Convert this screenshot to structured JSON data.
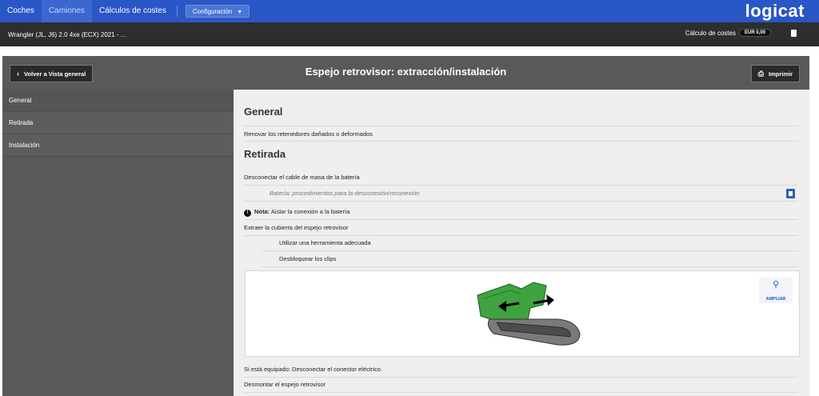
{
  "nav": {
    "items": [
      "Coches",
      "Camiones",
      "Cálculos de costes"
    ],
    "config_label": "Configuración",
    "logo": "logicat"
  },
  "vehicle": {
    "title": "Wrangler (JL, J6) 2.0 4xe (ECX) 2021 - ...",
    "cost_label": "Cálculo de costes",
    "cost_value": "EUR 0,00"
  },
  "header": {
    "back_label": "Volver a Vista general",
    "title": "Espejo retrovisor: extracción/instalación",
    "print_label": "Imprimir"
  },
  "sidebar": {
    "items": [
      "General",
      "Retirada",
      "Instalación"
    ]
  },
  "content": {
    "general_heading": "General",
    "general_rows": [
      "Renovar los retenedores dañados o deformados"
    ],
    "retirada_heading": "Retirada",
    "rows": {
      "r1": "Desconectar el cable de masa de la batería",
      "r2": "Batería: procedimientos para la desconexión/reconexión",
      "note_prefix": "Nota:",
      "note_text": "Aislar la conexión a la batería",
      "r3": "Extraer la cubierta del espejo retrovisor",
      "r4": "Utilizar una herramienta adecuada",
      "r5": "Desbloquear los clips",
      "r6": "Si está equipado: Desconectar el conector eléctrico.",
      "r7": "Desmontar el espejo retrovisor"
    },
    "zoom_label": "AMPLIAR"
  },
  "colors": {
    "nav": "#2a57c6",
    "vehicle_bar": "#2e2e2e",
    "header": "#595959",
    "content_bg": "#efefef",
    "mirror_green": "#3fa33f"
  },
  "icons": [
    "chevron-left-icon",
    "print-icon",
    "calculator-icon",
    "caret-down-icon",
    "info-icon",
    "document-icon",
    "magnifier-icon"
  ]
}
